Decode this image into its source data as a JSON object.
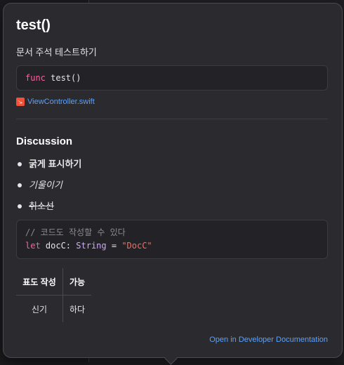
{
  "popover": {
    "title": "test()",
    "summary": "문서 주석 테스트하기",
    "declaration": {
      "keyword": "func",
      "rest": " test()"
    },
    "file_link": "ViewController.swift",
    "discussion_title": "Discussion",
    "bullets": [
      {
        "text": "굵게 표시하기",
        "style": "bold"
      },
      {
        "text": "기울이기",
        "style": "italic"
      },
      {
        "text": "취소선",
        "style": "strike"
      }
    ],
    "code": {
      "comment": "// 코드도 작성할 수 있다",
      "kw": "let",
      "ident": " docC: ",
      "type": "String",
      "eq": " = ",
      "string": "\"DocC\""
    },
    "table": {
      "headers": [
        "표도 작성",
        "가능"
      ],
      "row": [
        "신기",
        "하다"
      ]
    },
    "dev_link": "Open in Developer Documentation"
  },
  "colors": {
    "accent_link": "#5aa2ff",
    "keyword": "#fc5fa3",
    "string": "#fc6a5d",
    "type": "#d0a8ff",
    "comment": "#8a8a8f"
  },
  "icons": {
    "file": "swift-icon"
  }
}
